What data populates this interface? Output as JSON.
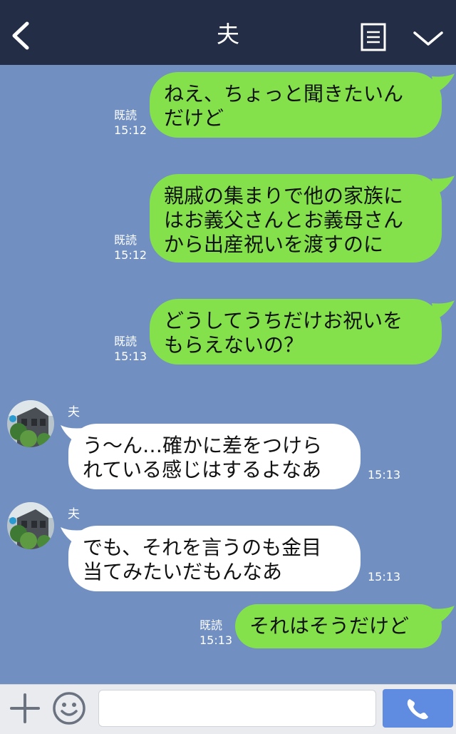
{
  "header": {
    "title": "夫",
    "background": "#232d45"
  },
  "messages": [
    {
      "side": "me",
      "lines": [
        "ねえ、ちょっと聞きたいん",
        "だけど"
      ],
      "read": "既読",
      "time": "15:12"
    },
    {
      "side": "me",
      "lines": [
        "親戚の集まりで他の家族に",
        "はお義父さんとお義母さん",
        "から出産祝いを渡すのに"
      ],
      "read": "既読",
      "time": "15:12"
    },
    {
      "side": "me",
      "lines": [
        "どうしてうちだけお祝いを",
        "もらえないの？"
      ],
      "read": "既読",
      "time": "15:13"
    },
    {
      "side": "other",
      "sender": "夫",
      "lines": [
        "う～ん…確かに差をつけら",
        "れている感じはするよなあ"
      ],
      "time": "15:13"
    },
    {
      "side": "other",
      "sender": "夫",
      "lines": [
        "でも、それを言うのも金目",
        "当てみたいだもんなあ"
      ],
      "time": "15:13"
    },
    {
      "side": "me",
      "lines": [
        "それはそうだけど"
      ],
      "read": "既読",
      "time": "15:13"
    }
  ],
  "colors": {
    "chat_background": "#7190c1",
    "my_bubble": "#84e04b",
    "other_bubble": "#ffffff",
    "call_button": "#5f8be0"
  },
  "icons": [
    "back-arrow-icon",
    "menu-note-icon",
    "chevron-down-icon",
    "plus-icon",
    "emoji-icon",
    "phone-icon"
  ],
  "footer": {
    "input_value": "",
    "input_placeholder": ""
  }
}
